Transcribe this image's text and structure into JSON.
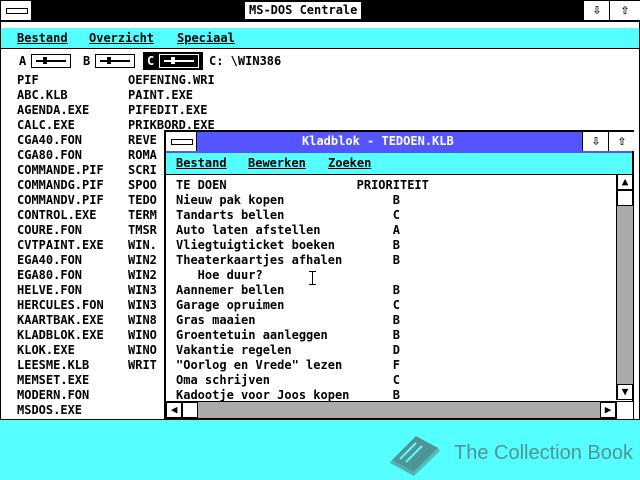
{
  "main_window": {
    "title": "MS-DOS Centrale",
    "minimize_symbol": "⇩",
    "maximize_symbol": "⇧",
    "menu": [
      "Bestand",
      "Overzicht",
      "Speciaal"
    ],
    "drives": [
      {
        "letter": "A",
        "selected": false
      },
      {
        "letter": "B",
        "selected": false
      },
      {
        "letter": "C",
        "selected": true
      }
    ],
    "path": "C: \\WIN386",
    "files_col1": [
      "PIF",
      "ABC.KLB",
      "AGENDA.EXE",
      "CALC.EXE",
      "CGA40.FON",
      "CGA80.FON",
      "COMMANDE.PIF",
      "COMMANDG.PIF",
      "COMMANDV.PIF",
      "CONTROL.EXE",
      "COURE.FON",
      "CVTPAINT.EXE",
      "EGA40.FON",
      "EGA80.FON",
      "HELVE.FON",
      "HERCULES.FON",
      "KAARTBAK.EXE",
      "KLADBLOK.EXE",
      "KLOK.EXE",
      "LEESME.KLB",
      "MEMSET.EXE",
      "MODERN.FON",
      "MSDOS.EXE"
    ],
    "files_col2": [
      "OEFENING.WRI",
      "PAINT.EXE",
      "PIFEDIT.EXE",
      "PRIKBORD.EXE",
      "REVE",
      "ROMA",
      "SCRI",
      "SPOO",
      "TEDO",
      "TERM",
      "TMSR",
      "WIN.",
      "WIN2",
      "WIN2",
      "WIN3",
      "WIN3",
      "WIN8",
      "WINO",
      "WINO",
      "WRIT"
    ]
  },
  "notepad": {
    "title": "Kladblok - TEDOEN.KLB",
    "minimize_symbol": "⇩",
    "maximize_symbol": "⇧",
    "menu": [
      "Bestand",
      "Bewerken",
      "Zoeken"
    ],
    "lines": [
      "TE DOEN                  PRIORITEIT",
      "Nieuw pak kopen               B",
      "Tandarts bellen               C",
      "Auto laten afstellen          A",
      "Vliegtuigticket boeken        B",
      "Theaterkaartjes afhalen       B",
      "   Hoe duur?",
      "Aannemer bellen               B",
      "Garage opruimen               C",
      "Gras maaien                   B",
      "Groentetuin aanleggen         B",
      "Vakantie regelen              D",
      "\"Oorlog en Vrede\" lezen       F",
      "Oma schrijven                 C",
      "Kadootje voor Joos kopen      B"
    ],
    "vscroll_up_symbol": "▲",
    "vscroll_down_symbol": "▼",
    "hscroll_left_symbol": "◀",
    "hscroll_right_symbol": "▶"
  },
  "watermark": {
    "text": "The Collection Book",
    "icon": "book-icon"
  },
  "colors": {
    "desktop": "#55ffff",
    "title_active": "#5555ff",
    "menu_bar": "#55ffff",
    "watermark": "#4f9596"
  }
}
